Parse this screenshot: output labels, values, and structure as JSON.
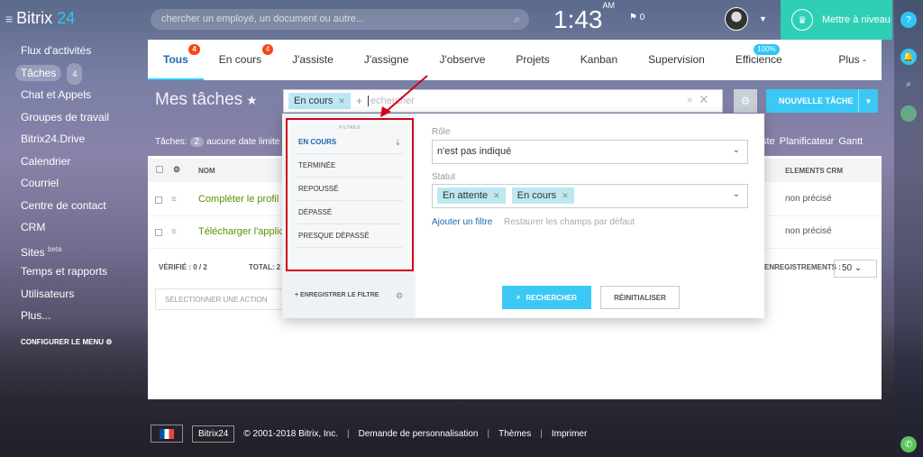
{
  "topbar": {
    "logo_text": "Bitrix",
    "logo_num": "24",
    "search_placeholder": "chercher un employé, un document ou autre...",
    "time": "1:43",
    "ampm": "AM",
    "flag_count": "0",
    "upgrade_label": "Mettre à niveau"
  },
  "sidebar": {
    "items": [
      {
        "label": "Flux d'activités"
      },
      {
        "label": "Tâches",
        "count": "4"
      },
      {
        "label": "Chat et Appels"
      },
      {
        "label": "Groupes de travail"
      },
      {
        "label": "Bitrix24.Drive"
      },
      {
        "label": "Calendrier"
      },
      {
        "label": "Courriel"
      },
      {
        "label": "Centre de contact"
      },
      {
        "label": "CRM"
      },
      {
        "label": "Sites",
        "sup": "beta"
      },
      {
        "label": "Temps et rapports"
      },
      {
        "label": "Utilisateurs"
      },
      {
        "label": "Plus..."
      }
    ],
    "configure": "CONFIGURER LE MENU"
  },
  "tabs": [
    {
      "label": "Tous",
      "badge": "4"
    },
    {
      "label": "En cours",
      "badge": "4"
    },
    {
      "label": "J'assiste"
    },
    {
      "label": "J'assigne"
    },
    {
      "label": "J'observe"
    },
    {
      "label": "Projets"
    },
    {
      "label": "Kanban"
    },
    {
      "label": "Supervision"
    },
    {
      "label": "Efficience",
      "badge": "100%"
    },
    {
      "label": "Plus -"
    }
  ],
  "page": {
    "title": "Mes tâches",
    "filter_chip": "En cours",
    "filter_input": "echercher",
    "new_task": "NOUVELLE TÂCHE",
    "subbar_label": "Tâches",
    "subbar_count": "2",
    "subbar_text": "aucune date limite",
    "views": "ste  Planificateur  Gantt"
  },
  "table": {
    "col_name": "NOM",
    "col_crm": "ELEMENTS CRM",
    "rows": [
      {
        "name": "Compléter le profil",
        "crm": "non précisé"
      },
      {
        "name": "Télécharger l'applicatio",
        "crm": "non précisé"
      }
    ],
    "verified": "VÉRIFIÉ : 0 / 2",
    "total": "TOTAL: 2",
    "records_label": "ENREGISTREMENTS :",
    "per_page": "50",
    "action_select": "SÉLECTIONNER UNE ACTION"
  },
  "filter_popup": {
    "presets_header": "FILTRES",
    "presets": [
      "EN COURS",
      "TERMINÉE",
      "REPOUSSÉ",
      "DÉPASSÉ",
      "PRESQUE DÉPASSÉ"
    ],
    "save_filter": "ENREGISTRER LE FILTRE",
    "role_label": "Rôle",
    "role_value": "n'est pas indiqué",
    "status_label": "Statut",
    "status_chips": [
      "En attente",
      "En cours"
    ],
    "add_field": "Ajouter un filtre",
    "restore": "Restaurer les champs par défaut",
    "search_btn": "RECHERCHER",
    "reset_btn": "RÉINITIALISER"
  },
  "footer": {
    "brand": "Bitrix24",
    "copyright": "© 2001-2018 Bitrix, Inc.",
    "links": [
      "Demande de personnalisation",
      "Thèmes",
      "Imprimer"
    ]
  },
  "colors": {
    "accent": "#2fc6f6",
    "highlight": "#d0021b",
    "upgrade": "#2fcfb6"
  }
}
